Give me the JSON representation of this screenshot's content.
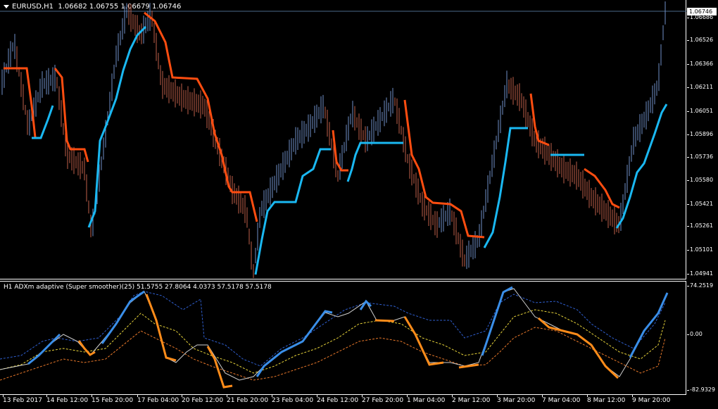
{
  "main": {
    "symbol_label": "EURUSD,H1",
    "ohlc": "1.06682 1.06755 1.06679 1.06746",
    "current_price": "1.06746",
    "price_ticks": [
      "1.06686",
      "1.06526",
      "1.06366",
      "1.06211",
      "1.06051",
      "1.05896",
      "1.05736",
      "1.05580",
      "1.05421",
      "1.05261",
      "1.05101",
      "1.04941"
    ]
  },
  "indicator": {
    "label": "H1 ADXm adaptive (Super smoother)(25) 51.5755 27.8064 4.0373 57.5178 57.5178",
    "scale_ticks": [
      "74.2519",
      "0.00",
      "-82.9329"
    ]
  },
  "time_axis": [
    "13 Feb 2017",
    "14 Feb 12:00",
    "15 Feb 20:00",
    "17 Feb 04:00",
    "20 Feb 12:00",
    "21 Feb 20:00",
    "23 Feb 04:00",
    "24 Feb 12:00",
    "27 Feb 20:00",
    "1 Mar 04:00",
    "2 Mar 12:00",
    "3 Mar 20:00",
    "7 Mar 04:00",
    "8 Mar 12:00",
    "9 Mar 20:00"
  ],
  "colors": {
    "bull_bar": "#6f8fc7",
    "bear_bar": "#c0604a",
    "trend_up": "#1ab8f2",
    "trend_down": "#ff4d10",
    "adx_up": "#3a8ee8",
    "adx_down": "#ff8c1a",
    "dash_blue": "#2f5fd0",
    "dash_yellow": "#e8d43a",
    "dash_orange": "#e8782a"
  }
}
